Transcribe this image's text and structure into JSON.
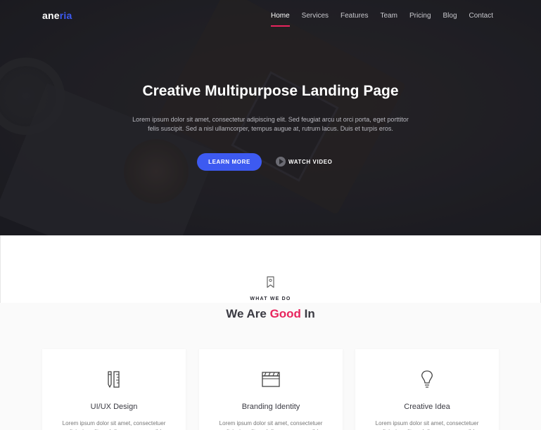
{
  "brand": {
    "logo_main": "ane",
    "logo_accent": "ria",
    "accent_color": "#3d5af1",
    "highlight_color": "#e8245d"
  },
  "nav": {
    "items": [
      "Home",
      "Services",
      "Features",
      "Team",
      "Pricing",
      "Blog",
      "Contact"
    ],
    "active": "Home"
  },
  "hero": {
    "title": "Creative Multipurpose Landing Page",
    "text": "Lorem ipsum dolor sit amet, consectetur adipiscing elit. Sed feugiat arcu ut orci porta, eget porttitor felis suscipit. Sed a nisl ullamcorper, tempus augue at, rutrum lacus. Duis et turpis eros.",
    "primary_button": "LEARN MORE",
    "secondary_button": "WATCH VIDEO"
  },
  "services": {
    "icon": "bookmark-icon",
    "kicker": "WHAT WE DO",
    "heading_pre": "We Are ",
    "heading_highlight": "Good",
    "heading_post": " In",
    "cards": [
      {
        "icon": "pencil-ruler-icon",
        "title": "UI/UX Design",
        "text": "Lorem ipsum dolor sit amet, consectetuer adipiscing elit, sed diam nonummy nibh"
      },
      {
        "icon": "clapperboard-icon",
        "title": "Branding Identity",
        "text": "Lorem ipsum dolor sit amet, consectetuer adipiscing elit, sed diam nonummy nibh"
      },
      {
        "icon": "lightbulb-icon",
        "title": "Creative Idea",
        "text": "Lorem ipsum dolor sit amet, consectetuer adipiscing elit, sed diam nonummy nibh"
      }
    ]
  }
}
